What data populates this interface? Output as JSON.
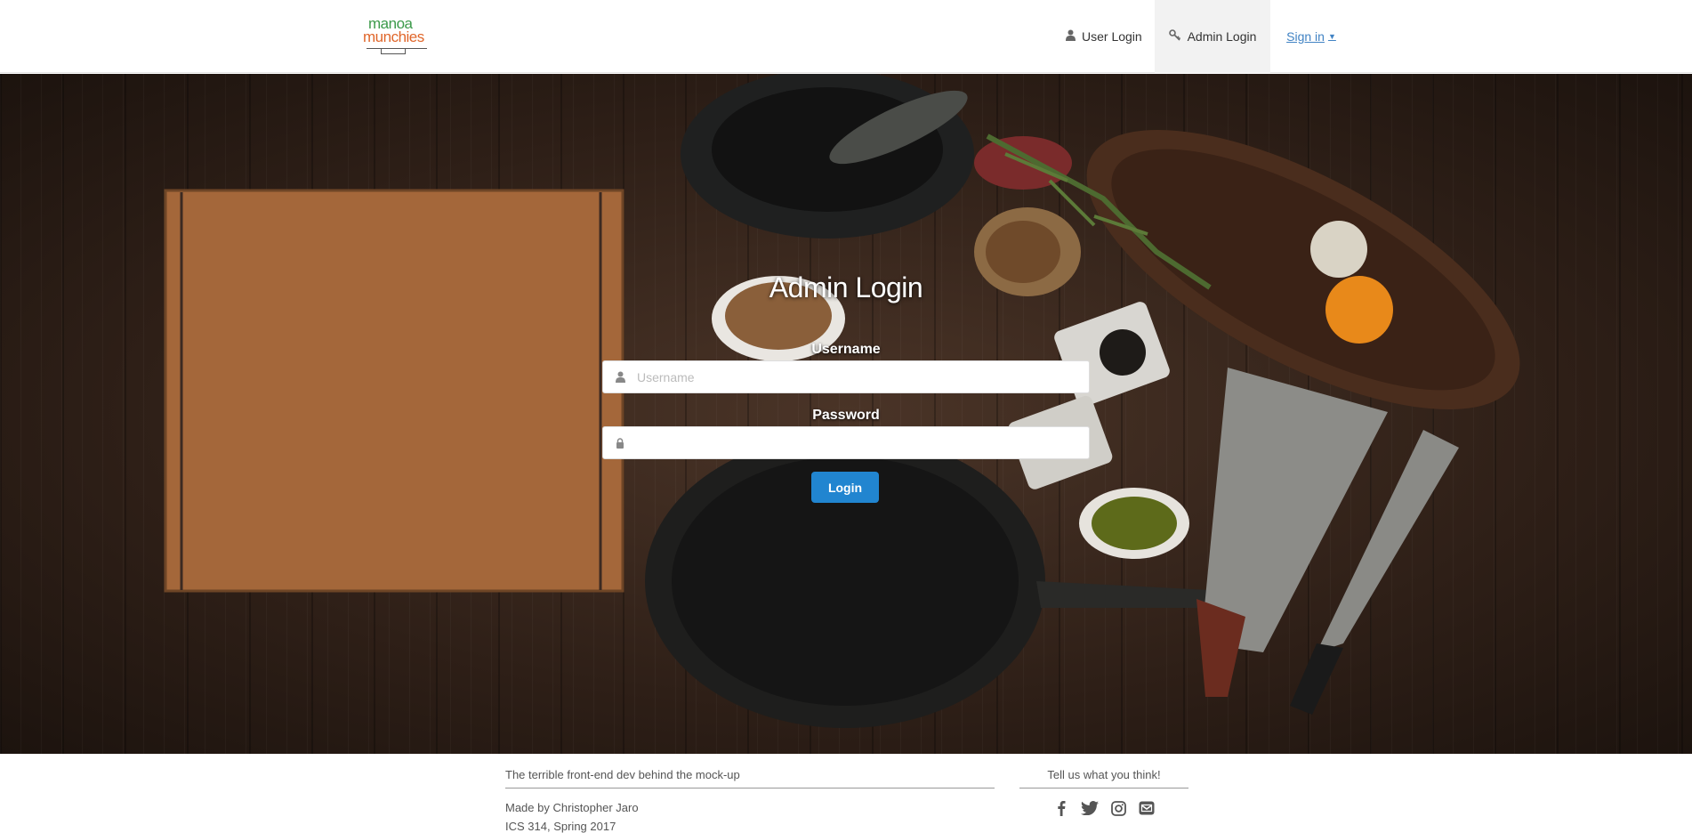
{
  "logo": {
    "line1": "manoa",
    "line2": "munchies"
  },
  "nav": {
    "user_login": "User Login",
    "admin_login": "Admin Login",
    "sign_in": "Sign in",
    "sign_in_caret": "▼"
  },
  "login": {
    "title": "Admin Login",
    "username_label": "Username",
    "username_placeholder": "Username",
    "password_label": "Password",
    "login_button": "Login"
  },
  "footer": {
    "left_heading": "The terrible front-end dev behind the mock-up",
    "made_by": "Made by Christopher Jaro",
    "course": "ICS 314, Spring 2017",
    "right_heading": "Tell us what you think!",
    "social_icons": [
      "facebook-icon",
      "twitter-icon",
      "instagram-icon",
      "mail-icon"
    ]
  },
  "colors": {
    "primary_button": "#2185d0",
    "link": "#4183c4",
    "logo_green": "#3c9a4a",
    "logo_orange": "#e0662a"
  }
}
